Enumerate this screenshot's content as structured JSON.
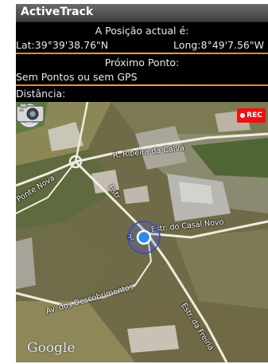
{
  "app": {
    "title": "ActiveTrack"
  },
  "position": {
    "header": "A Posição actual é:",
    "lat": "Lat:39°39'38.76\"N",
    "long": "Long:8°49'7.56\"W"
  },
  "next_point": {
    "header": "Próximo Ponto:",
    "value": "Sem Pontos  ou sem GPS"
  },
  "distance": {
    "label": "Distância:"
  },
  "map": {
    "rec_label": "REC",
    "attribution": "Google",
    "roads": [
      "R. Ribeira da Calva",
      "Ponte Nova",
      "Estr. do Casal Novo",
      "Av. dos Descobrimentos",
      "Estr. da Freiria"
    ],
    "road_partial": [
      "Estr",
      "R."
    ],
    "icons": [
      "compass-icon",
      "location-marker-icon",
      "camera-icon",
      "record-dot-icon"
    ]
  },
  "colors": {
    "accent_line": "#f29a2e",
    "rec_red": "#e11111",
    "location_blue": "#2a8ee8"
  }
}
